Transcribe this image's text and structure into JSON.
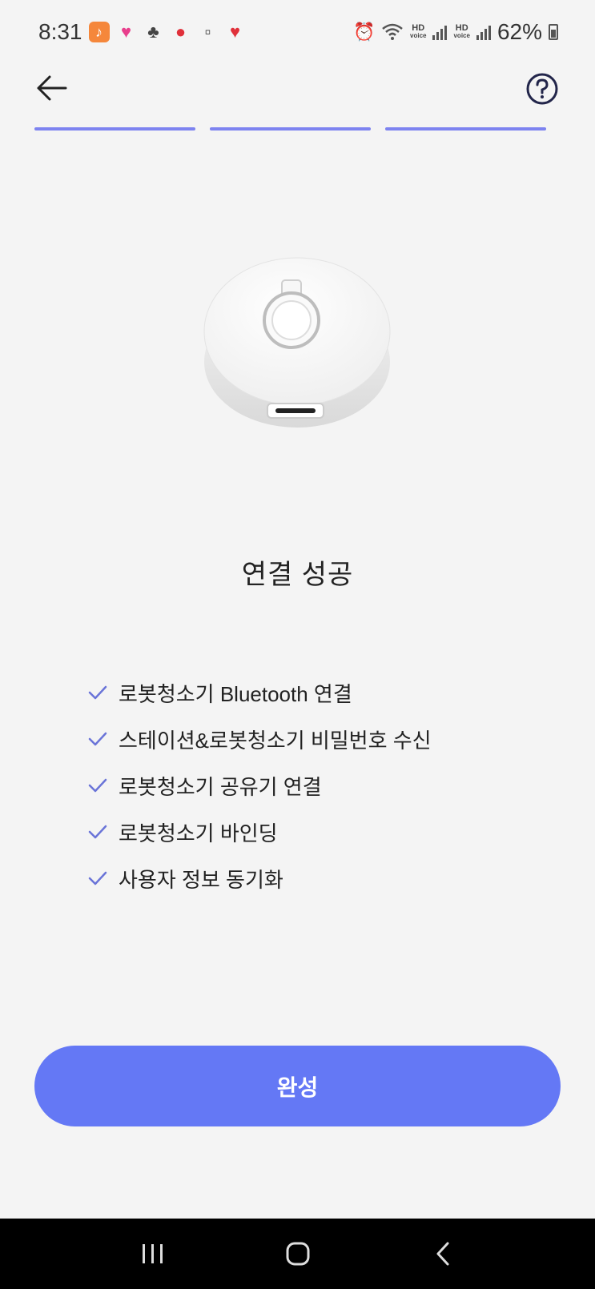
{
  "status_bar": {
    "time": "8:31",
    "battery_text": "62%",
    "hd_label": "HD",
    "voice_label": "voice"
  },
  "page": {
    "title": "연결 성공"
  },
  "checklist": [
    {
      "label": "로봇청소기 Bluetooth 연결"
    },
    {
      "label": "스테이션&로봇청소기 비밀번호 수신"
    },
    {
      "label": "로봇청소기 공유기 연결"
    },
    {
      "label": "로봇청소기 바인딩"
    },
    {
      "label": "사용자 정보 동기화"
    }
  ],
  "progress": {
    "segments_total": 3,
    "segments_done": 3
  },
  "actions": {
    "complete_label": "완성"
  },
  "colors": {
    "accent": "#6478f5",
    "progress": "#7d83f0",
    "check": "#6a74d8",
    "background": "#f4f4f4"
  },
  "icons": {
    "back": "arrow-left-icon",
    "help": "question-circle-icon",
    "check": "check-icon",
    "nav_recent": "recent-apps-icon",
    "nav_home": "home-icon",
    "nav_back": "nav-back-icon"
  }
}
